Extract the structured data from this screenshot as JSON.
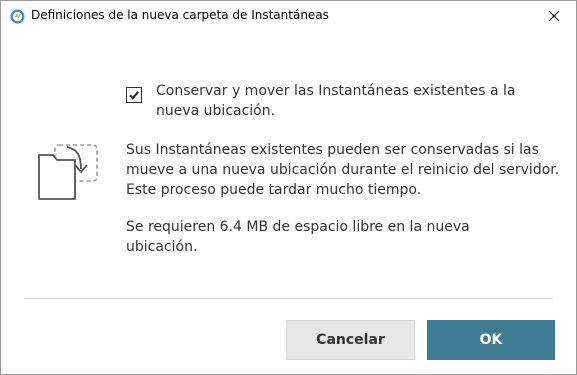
{
  "dialog": {
    "title": "Definiciones de la nueva carpeta de Instantáneas",
    "app_icon": "parallels-icon",
    "close_icon": "close-icon",
    "close_glyph": "✕"
  },
  "content": {
    "illustration_icon": "folder-move-icon",
    "checkbox": {
      "checked": true,
      "label": "Conservar y mover las Instantáneas existentes a la nueva ubicación."
    },
    "description": "Sus Instantáneas existentes pueden ser conservadas si las mueve a una nueva ubicación durante el reinicio del servidor. Este proceso puede tardar mucho tiempo.",
    "space_note": "Se requieren 6.4 MB de espacio libre en la nueva ubicación."
  },
  "buttons": {
    "cancel_label": "Cancelar",
    "ok_label": "OK"
  },
  "colors": {
    "ok_button": "#417c95",
    "cancel_button": "#e6e6e6",
    "app_icon": "#2e9ad6"
  }
}
